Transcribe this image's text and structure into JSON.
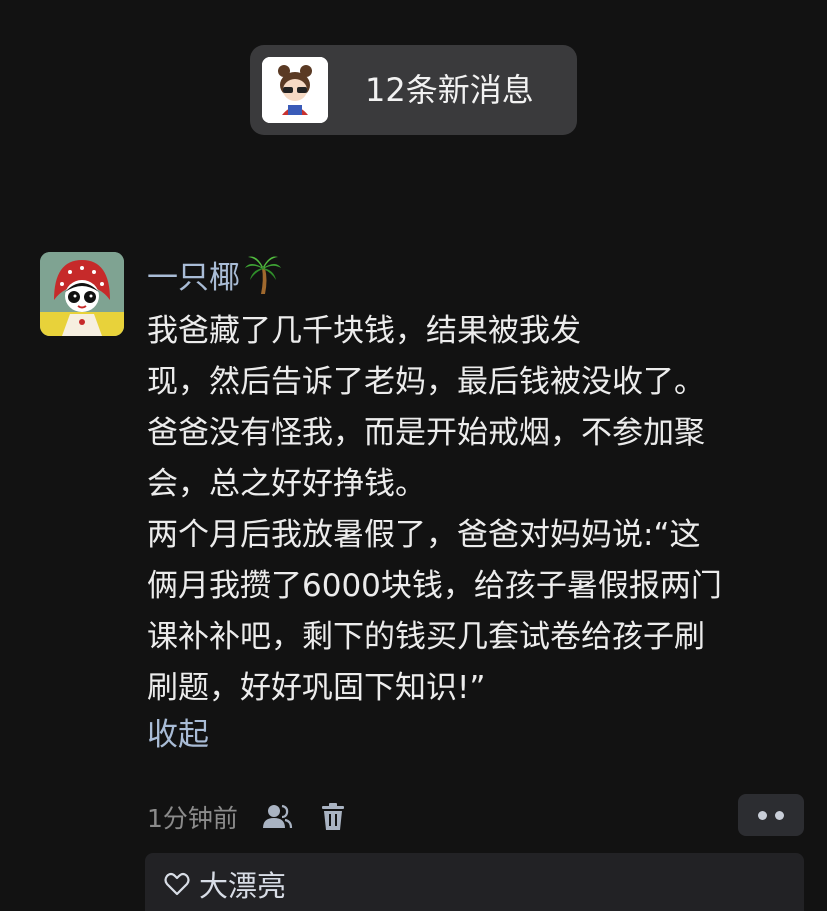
{
  "notification": {
    "label": "12条新消息"
  },
  "comment": {
    "username": "一只椰",
    "username_emoji": "palm-tree-icon",
    "body_lines": [
      "我爸藏了几千块钱，结果被我发",
      "现，然后告诉了老妈，最后钱被没收了。",
      "爸爸没有怪我，而是开始戒烟，不参加聚",
      "会，总之好好挣钱。",
      "两个月后我放暑假了，爸爸对妈妈说:“这",
      "俩月我攒了6000块钱，给孩子暑假报两门",
      "课补补吧，剩下的钱买几套试卷给孩子刷",
      "刷题，好好巩固下知识!”"
    ],
    "collapse_label": "收起",
    "time": "1分钟前",
    "likes": {
      "liker": "大漂亮"
    }
  },
  "colors": {
    "background": "#121212",
    "link": "#a9bcd6",
    "text": "#ececec",
    "meta": "#8b8b8b"
  }
}
